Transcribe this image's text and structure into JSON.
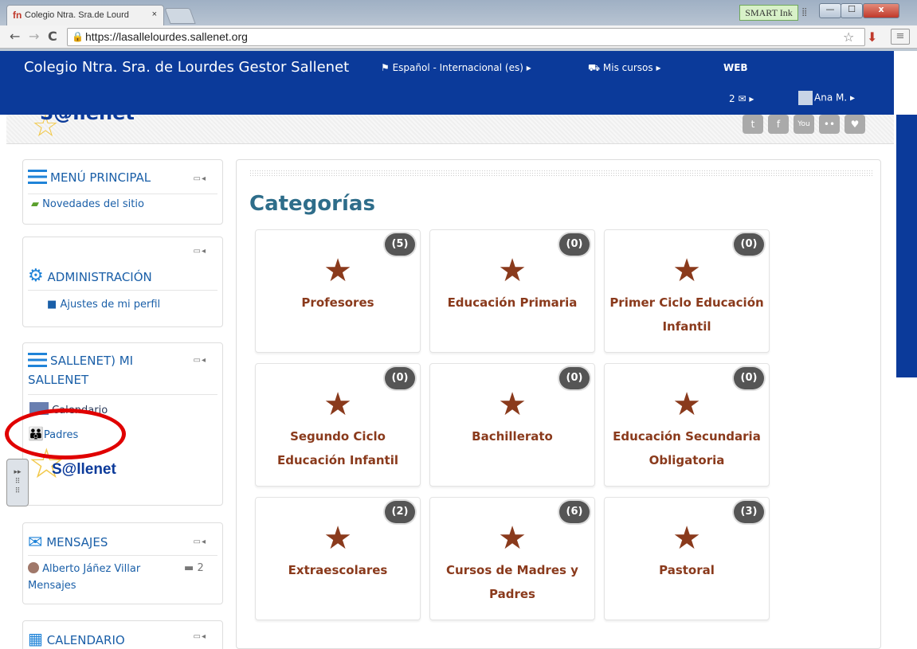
{
  "browser": {
    "tab_title": "Colegio Ntra. Sra.de Lourd",
    "tab_close": "×",
    "favicon": "fn",
    "smart_ink": "SMART Ink",
    "url": "https://lasallelourdes.sallenet.org",
    "back": "←",
    "forward": "→",
    "reload": "C",
    "lock": "🔒",
    "star": "☆",
    "menu": "≡",
    "win_min": "—",
    "win_max": "☐",
    "win_close": "x"
  },
  "navbar": {
    "brand": "Colegio Ntra. Sra. de Lourdes Gestor Sallenet",
    "language": "⚑ Español - Internacional (es) ▸",
    "my_courses": "⛟ Mis cursos ▸",
    "web": "WEB",
    "messages": "2 ✉  ▸",
    "user": "Ana M. ▸"
  },
  "header": {
    "logo_text": "S@llenet",
    "social": [
      "t",
      "f",
      "You",
      "••",
      "♥"
    ]
  },
  "blocks": {
    "menu": {
      "title": "MENÚ PRINCIPAL",
      "item": "Novedades del sitio"
    },
    "admin": {
      "title": "ADMINISTRACIÓN",
      "item": "Ajustes de mi perfil"
    },
    "sallenet": {
      "title_line1": "SALLENET) MI",
      "title_line2": "SALLENET",
      "item_calendar": "Calendario",
      "item_parents": "Padres",
      "logo": "S@llenet"
    },
    "messages": {
      "title": "MENSAJES",
      "sender": "Alberto Jáñez Villar",
      "count": "2",
      "link": "Mensajes"
    },
    "calendar": {
      "title": "CALENDARIO"
    },
    "controls": "▭◂"
  },
  "main": {
    "title": "Categorías",
    "categories": [
      {
        "name": "Profesores",
        "count": "(5)"
      },
      {
        "name": "Educación Primaria",
        "count": "(0)"
      },
      {
        "name": "Primer Ciclo Educación Infantil",
        "count": "(0)"
      },
      {
        "name": "Segundo Ciclo Educación Infantil",
        "count": "(0)"
      },
      {
        "name": "Bachillerato",
        "count": "(0)"
      },
      {
        "name": "Educación Secundaria Obligatoria",
        "count": "(0)"
      },
      {
        "name": "Extraescolares",
        "count": "(2)"
      },
      {
        "name": "Cursos de Madres y Padres",
        "count": "(6)"
      },
      {
        "name": "Pastoral",
        "count": "(3)"
      }
    ]
  },
  "colors": {
    "navbar": "#0b3a9a",
    "category": "#8a3a1c",
    "heading": "#2e6d8a",
    "annotation": "#e00000"
  }
}
